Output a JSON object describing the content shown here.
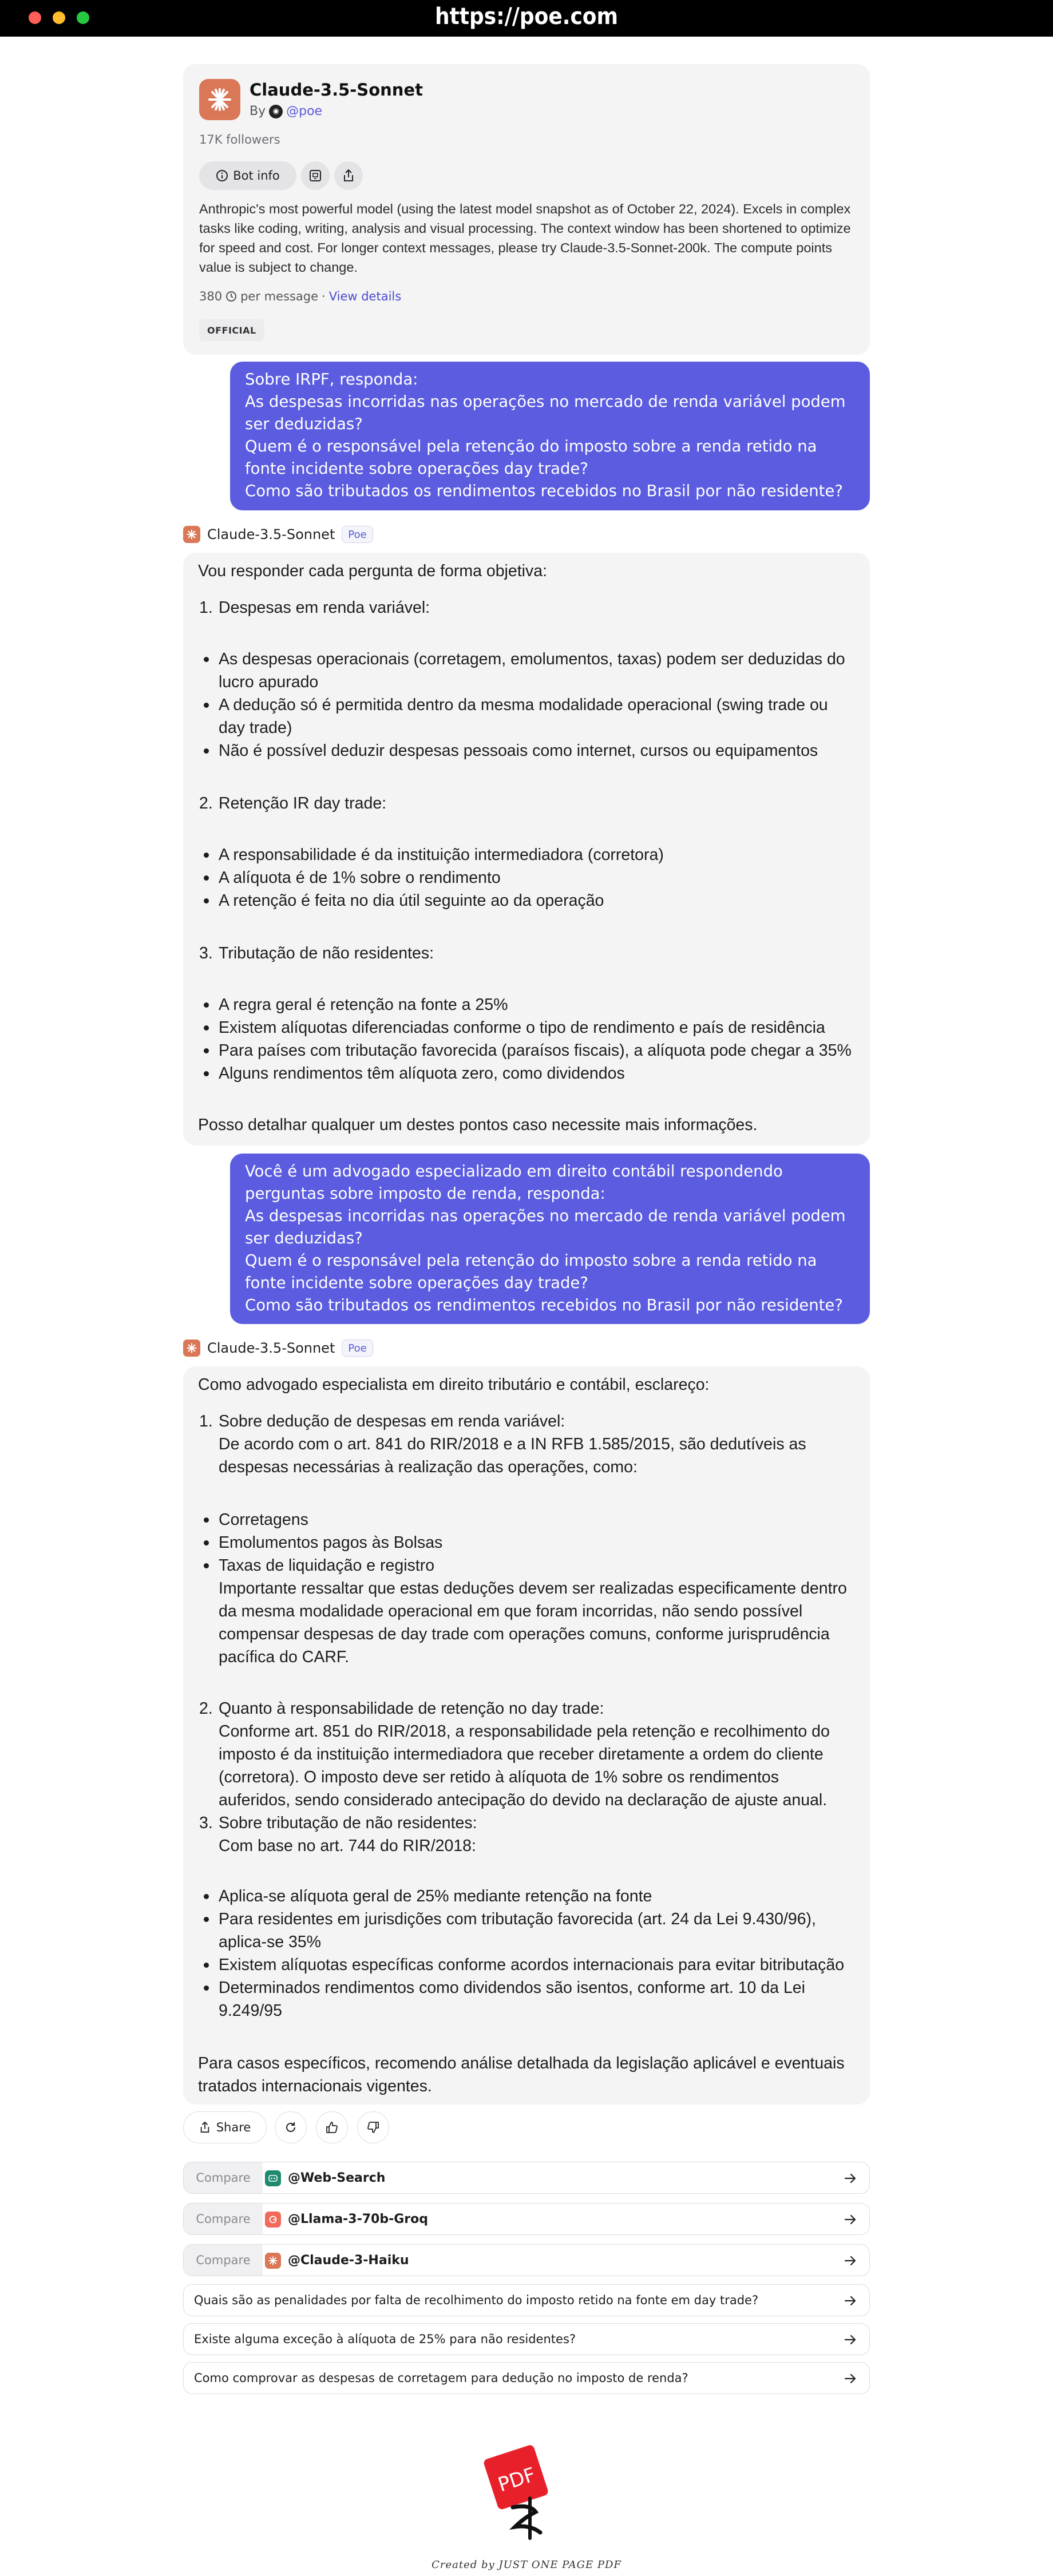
{
  "browser": {
    "url": "https://poe.com"
  },
  "bot": {
    "name": "Claude-3.5-Sonnet",
    "by_label": "By",
    "handle": "@poe",
    "followers": "17K followers",
    "bot_info_label": "Bot info",
    "description": "Anthropic's most powerful model (using the latest model snapshot as of October 22, 2024). Excels in complex tasks like coding, writing, analysis and visual processing. The context window has been shortened to optimize for speed and cost. For longer context messages, please try Claude-3.5-Sonnet-200k. The compute points value is subject to change.",
    "points": "380",
    "points_suffix": "per message",
    "separator": "·",
    "view_details": "View details",
    "official_badge": "OFFICIAL",
    "tag": "Poe",
    "brand_color": "#d97757"
  },
  "messages": {
    "user1": [
      "Sobre IRPF, responda:",
      "As despesas incorridas nas operações no mercado de renda variável podem ser deduzidas?",
      "Quem é o responsável pela retenção do imposto sobre a renda retido na fonte incidente sobre operações day trade?",
      "Como são tributados os rendimentos recebidos no Brasil por não residente?"
    ],
    "bot1": {
      "intro": "Vou responder cada pergunta de forma objetiva:",
      "s1_title": "Despesas em renda variável:",
      "s1_items": [
        "As despesas operacionais (corretagem, emolumentos, taxas) podem ser deduzidas do lucro apurado",
        "A dedução só é permitida dentro da mesma modalidade operacional (swing trade ou day trade)",
        "Não é possível deduzir despesas pessoais como internet, cursos ou equipamentos"
      ],
      "s2_title": "Retenção IR day trade:",
      "s2_items": [
        "A responsabilidade é da instituição intermediadora (corretora)",
        "A alíquota é de 1% sobre o rendimento",
        "A retenção é feita no dia útil seguinte ao da operação"
      ],
      "s3_title": "Tributação de não residentes:",
      "s3_items": [
        "A regra geral é retenção na fonte a 25%",
        "Existem alíquotas diferenciadas conforme o tipo de rendimento e país de residência",
        "Para países com tributação favorecida (paraísos fiscais), a alíquota pode chegar a 35%",
        "Alguns rendimentos têm alíquota zero, como dividendos"
      ],
      "outro": "Posso detalhar qualquer um destes pontos caso necessite mais informações."
    },
    "user2": [
      "Você é um advogado especializado em direito contábil respondendo perguntas sobre imposto de renda, responda:",
      "As despesas incorridas nas operações no mercado de renda variável podem ser deduzidas?",
      "Quem é o responsável pela retenção do imposto sobre a renda retido na fonte incidente sobre operações day trade?",
      "Como são tributados os rendimentos recebidos no Brasil por não residente?"
    ],
    "bot2": {
      "intro": "Como advogado especialista em direito tributário e contábil, esclareço:",
      "s1_title": "Sobre dedução de despesas em renda variável:",
      "s1_body": "De acordo com o art. 841 do RIR/2018 e a IN RFB 1.585/2015, são dedutíveis as despesas necessárias à realização das operações, como:",
      "s1_items": [
        "Corretagens",
        "Emolumentos pagos às Bolsas",
        "Taxas de liquidação e registro"
      ],
      "s1_note": "Importante ressaltar que estas deduções devem ser realizadas especificamente dentro da mesma modalidade operacional em que foram incorridas, não sendo possível compensar despesas de day trade com operações comuns, conforme jurisprudência pacífica do CARF.",
      "s2_title": "Quanto à responsabilidade de retenção no day trade:",
      "s2_body": "Conforme art. 851 do RIR/2018, a responsabilidade pela retenção e recolhimento do imposto é da instituição intermediadora que receber diretamente a ordem do cliente (corretora). O imposto deve ser retido à alíquota de 1% sobre os rendimentos auferidos, sendo considerado antecipação do devido na declaração de ajuste anual.",
      "s3_title": "Sobre tributação de não residentes:",
      "s3_body": "Com base no art. 744 do RIR/2018:",
      "s3_items": [
        "Aplica-se alíquota geral de 25% mediante retenção na fonte",
        "Para residentes em jurisdições com tributação favorecida (art. 24 da Lei 9.430/96), aplica-se 35%",
        "Existem alíquotas específicas conforme acordos internacionais para evitar bitributação",
        "Determinados rendimentos como dividendos são isentos, conforme art. 10 da Lei 9.249/95"
      ],
      "outro": "Para casos específicos, recomendo análise detalhada da legislação aplicável e eventuais tratados internacionais vigentes."
    }
  },
  "actions": {
    "share_label": "Share"
  },
  "compare": {
    "label": "Compare",
    "bots": [
      {
        "name": "@Web-Search",
        "color": "#1f8a70"
      },
      {
        "name": "@Llama-3-70b-Groq",
        "color": "#f06a5a"
      },
      {
        "name": "@Claude-3-Haiku",
        "color": "#d97757"
      }
    ]
  },
  "suggestions": [
    "Quais são as penalidades por falta de recolhimento do imposto retido na fonte em day trade?",
    "Existe alguma exceção à alíquota de 25% para não residentes?",
    "Como comprovar as despesas de corretagem para dedução no imposto de renda?"
  ],
  "footer": {
    "logo_text": "PDF",
    "caption": "Created by JUST ONE PAGE PDF"
  }
}
